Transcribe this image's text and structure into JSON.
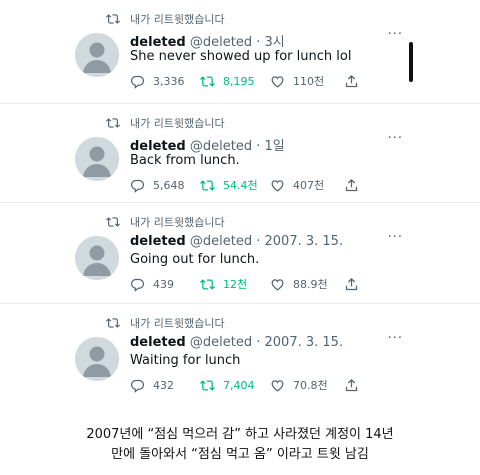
{
  "retweet_label": "내가 리트윗했습니다",
  "tweets": [
    {
      "name": "deleted",
      "handle": "@deleted",
      "dot": "·",
      "time": "3시",
      "text": "She never showed up for lunch lol",
      "replies": "3,336",
      "retweets": "8,195",
      "likes": "110천"
    },
    {
      "name": "deleted",
      "handle": "@deleted",
      "dot": "·",
      "time": "1일",
      "text": "Back from lunch.",
      "replies": "5,648",
      "retweets": "54.4천",
      "likes": "407천"
    },
    {
      "name": "deleted",
      "handle": "@deleted",
      "dot": "·",
      "time": "2007. 3. 15.",
      "text": "Going out for lunch.",
      "replies": "439",
      "retweets": "12천",
      "likes": "88.9천"
    },
    {
      "name": "deleted",
      "handle": "@deleted",
      "dot": "·",
      "time": "2007. 3. 15.",
      "text": "Waiting for lunch",
      "replies": "432",
      "retweets": "7,404",
      "likes": "70.8천"
    }
  ],
  "more_label": "···",
  "caption": {
    "line1": "2007년에 “점심 먹으러 감” 하고 사라졌던 계정이 14년",
    "line2": "만에 돌아와서 “점심 먹고 옴” 이라고 트윗 남김"
  },
  "colors": {
    "retweet_green": "#00ba7c",
    "muted": "#536471",
    "avatar": "#cfd9de"
  },
  "icons": [
    "retweet-icon",
    "reply-icon",
    "like-icon",
    "share-icon",
    "more-icon",
    "default-avatar"
  ]
}
